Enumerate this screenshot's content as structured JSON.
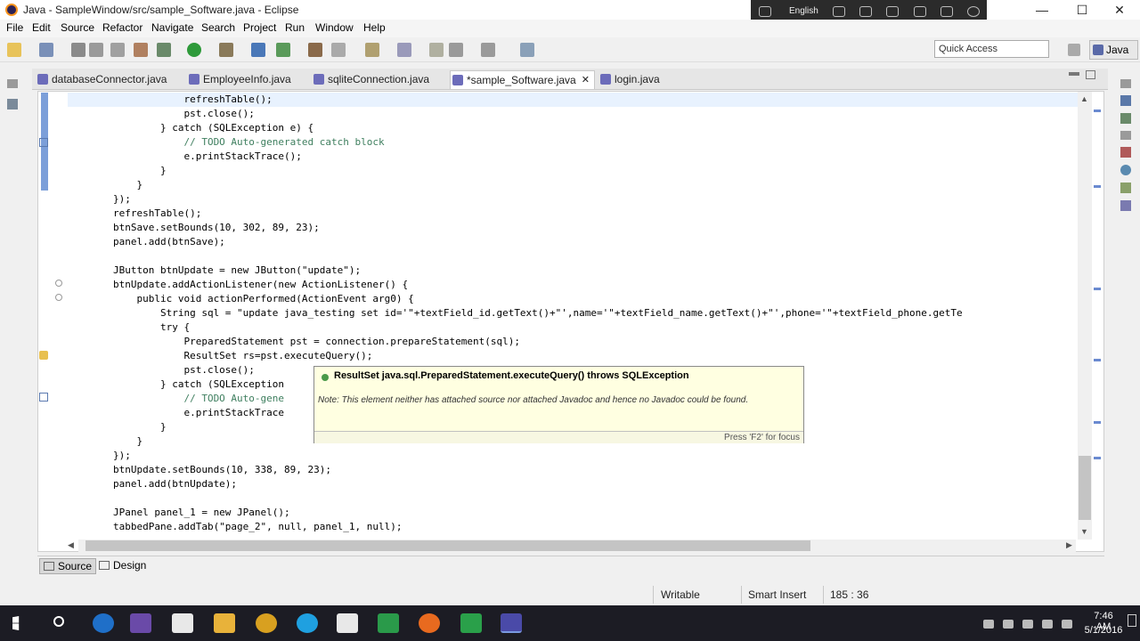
{
  "window": {
    "title": "Java - SampleWindow/src/sample_Software.java - Eclipse",
    "language": "English",
    "controls": {
      "minimize": "—",
      "maximize": "☐",
      "close": "✕"
    }
  },
  "menu": [
    "File",
    "Edit",
    "Source",
    "Refactor",
    "Navigate",
    "Search",
    "Project",
    "Run",
    "Window",
    "Help"
  ],
  "toolbar": {
    "quick_access": "Quick Access",
    "perspective": "Java"
  },
  "editor_tabs": [
    {
      "label": "databaseConnector.java",
      "active": false
    },
    {
      "label": "EmployeeInfo.java",
      "active": false
    },
    {
      "label": "sqliteConnection.java",
      "active": false
    },
    {
      "label": "*sample_Software.java",
      "active": true,
      "close": "✕"
    },
    {
      "label": "login.java",
      "active": false
    }
  ],
  "code_lines": [
    "                    refreshTable();",
    "                    pst.close();",
    "                } catch (SQLException e) {",
    "                    // TODO Auto-generated catch block",
    "                    e.printStackTrace();",
    "                }",
    "            }",
    "        });",
    "        refreshTable();",
    "        btnSave.setBounds(10, 302, 89, 23);",
    "        panel.add(btnSave);",
    "",
    "        JButton btnUpdate = new JButton(\"update\");",
    "        btnUpdate.addActionListener(new ActionListener() {",
    "            public void actionPerformed(ActionEvent arg0) {",
    "                String sql = \"update java_testing set id='\"+textField_id.getText()+\"',name='\"+textField_name.getText()+\"',phone='\"+textField_phone.getTe",
    "                try {",
    "                    PreparedStatement pst = connection.prepareStatement(sql);",
    "                    ResultSet rs=pst.executeQuery();",
    "                    pst.close();",
    "                } catch (SQLException",
    "                    // TODO Auto-gene",
    "                    e.printStackTrace",
    "                }",
    "            }",
    "        });",
    "        btnUpdate.setBounds(10, 338, 89, 23);",
    "        panel.add(btnUpdate);",
    "",
    "        JPanel panel_1 = new JPanel();",
    "        tabbedPane.addTab(\"page_2\", null, panel_1, null);"
  ],
  "hover_popup": {
    "title": "ResultSet java.sql.PreparedStatement.executeQuery() throws SQLException",
    "note": "Note: This element neither has attached source nor attached Javadoc and hence no Javadoc could be found.",
    "footer": "Press 'F2' for focus"
  },
  "bottom_tabs": {
    "source": "Source",
    "design": "Design"
  },
  "status": {
    "mode": "Writable",
    "insert": "Smart Insert",
    "position": "185 : 36"
  },
  "taskbar": {
    "time": "7:46 AM",
    "date": "5/1/2016"
  },
  "colors": {
    "keyword": "#7f0055",
    "string": "#2a00ff",
    "comment": "#3f7f5f",
    "field": "#0000c0",
    "popup_bg": "#ffffe1",
    "taskbar_bg": "#1c1c24"
  }
}
